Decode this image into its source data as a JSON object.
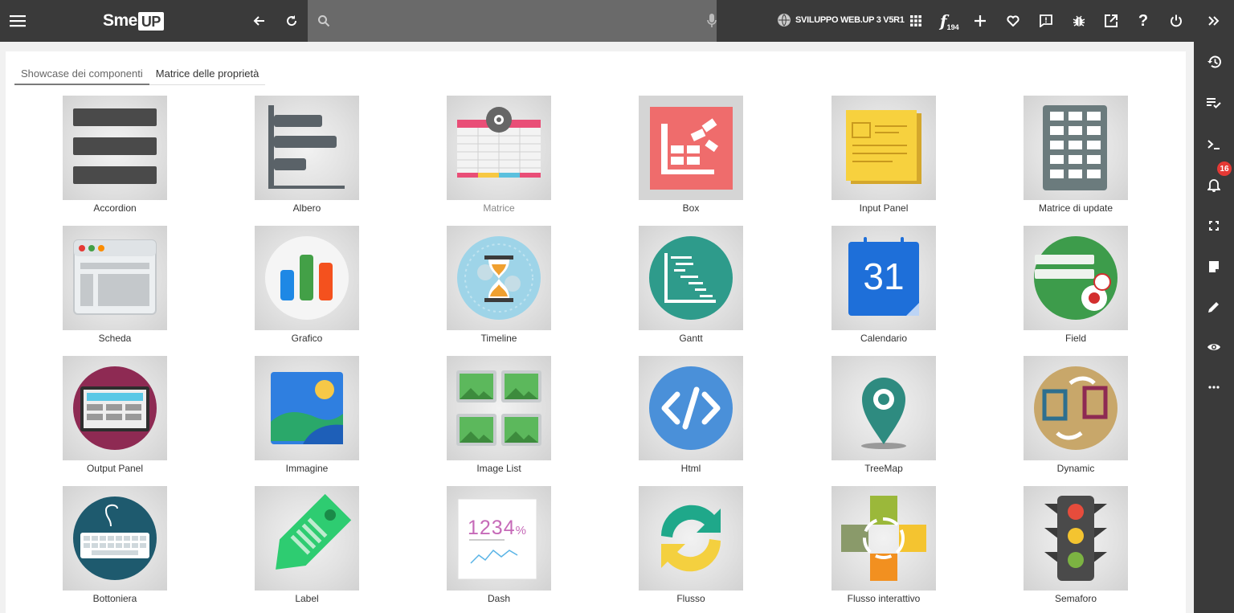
{
  "header": {
    "logo_text": "Sme",
    "logo_badge": "UP",
    "search_placeholder": "",
    "environment": "SVILUPPO WEB.UP 3 V5R1",
    "func_subscript": "194",
    "icons": [
      "menu-icon",
      "back-icon",
      "refresh-icon",
      "search-icon",
      "mic-icon",
      "globe-icon",
      "apps-icon",
      "function-icon",
      "plus-icon",
      "heart-icon",
      "feedback-icon",
      "bug-icon",
      "open-external-icon",
      "help-icon",
      "power-icon"
    ]
  },
  "rightbar": {
    "icons": [
      "collapse-icon",
      "history-icon",
      "playlist-check-icon",
      "terminal-icon",
      "bell-icon",
      "fullscreen-icon",
      "note-icon",
      "pencil-icon",
      "eye-icon",
      "more-icon"
    ],
    "notifications": "16"
  },
  "tabs": [
    {
      "label": "Showcase dei componenti",
      "active": true
    },
    {
      "label": "Matrice delle proprietà",
      "active": false
    }
  ],
  "components": [
    {
      "label": "Accordion"
    },
    {
      "label": "Albero"
    },
    {
      "label": "Matrice"
    },
    {
      "label": "Box"
    },
    {
      "label": "Input Panel"
    },
    {
      "label": "Matrice di update"
    },
    {
      "label": "Scheda"
    },
    {
      "label": "Grafico"
    },
    {
      "label": "Timeline"
    },
    {
      "label": "Gantt"
    },
    {
      "label": "Calendario",
      "icon_text": "31"
    },
    {
      "label": "Field"
    },
    {
      "label": "Output Panel"
    },
    {
      "label": "Immagine"
    },
    {
      "label": "Image List"
    },
    {
      "label": "Html"
    },
    {
      "label": "TreeMap"
    },
    {
      "label": "Dynamic"
    },
    {
      "label": "Bottoniera"
    },
    {
      "label": "Label"
    },
    {
      "label": "Dash",
      "icon_text": "1234",
      "icon_suffix": "%"
    },
    {
      "label": "Flusso"
    },
    {
      "label": "Flusso interattivo"
    },
    {
      "label": "Semaforo"
    }
  ],
  "colors": {
    "topbar": "#3a3a3a",
    "search": "#6a6a6a",
    "badge": "#e53935"
  }
}
